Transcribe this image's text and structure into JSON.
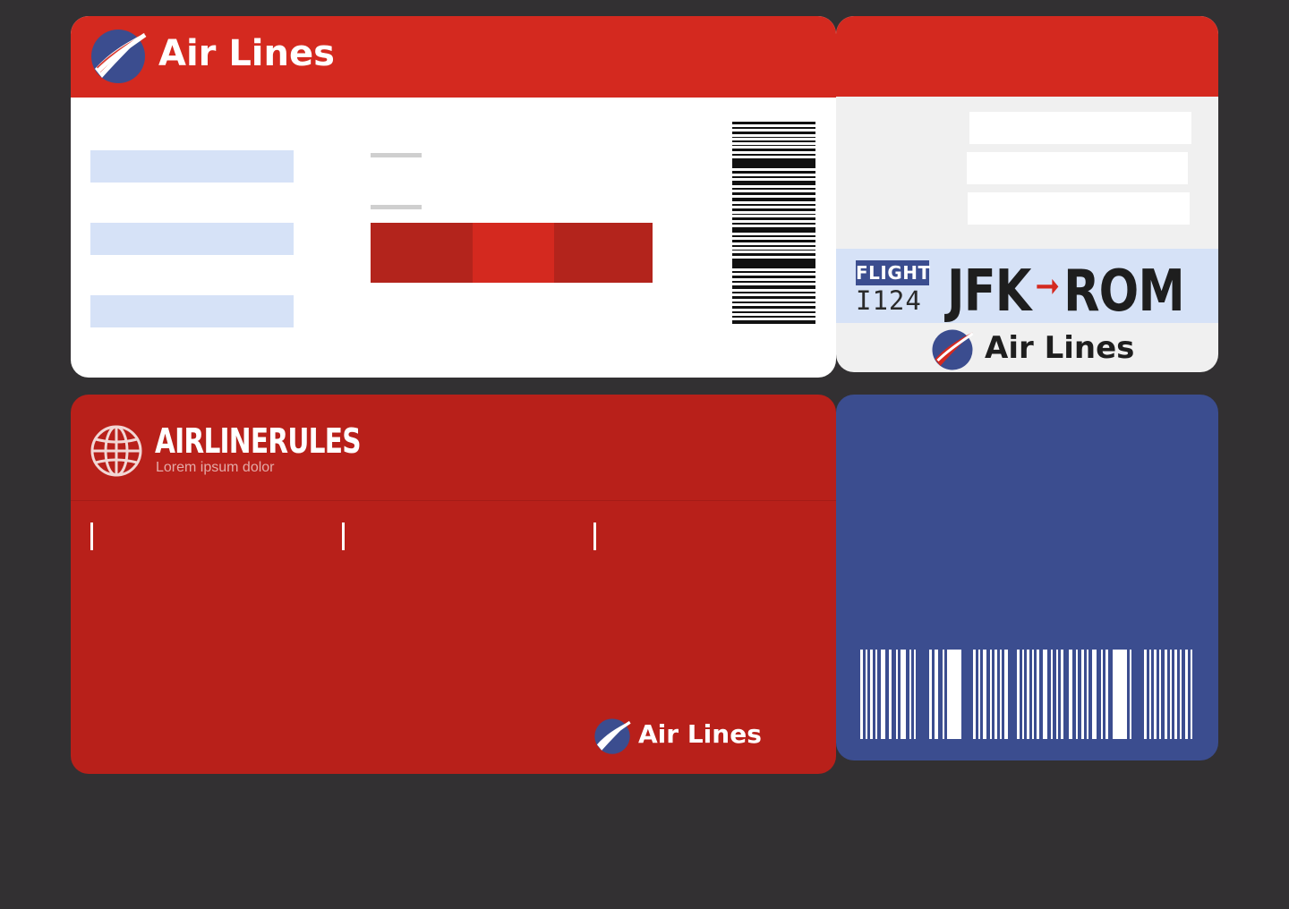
{
  "brand": {
    "name": "Air Lines",
    "colors": {
      "red": "#d4291f",
      "dark_red": "#b8201a",
      "navy": "#3b4d8f",
      "field_blue": "#d6e2f7",
      "background": "#323032"
    }
  },
  "front_card": {
    "logo_icon": "swoosh-globe-icon",
    "logo_text": "Air Lines",
    "barcode_icon": "barcode-icon"
  },
  "stub_card": {
    "flight_label": "FLIGHT",
    "flight_number": "I124",
    "origin": "JFK",
    "destination": "ROM",
    "route_arrow_icon": "arrow-right-icon",
    "logo_text": "Air Lines"
  },
  "rules_card": {
    "globe_icon": "globe-icon",
    "title": "AIRLINERULES",
    "subtitle": "Lorem ipsum dolor",
    "footer_logo_text": "Air Lines"
  },
  "back_card": {
    "barcode_icon": "barcode-icon"
  }
}
